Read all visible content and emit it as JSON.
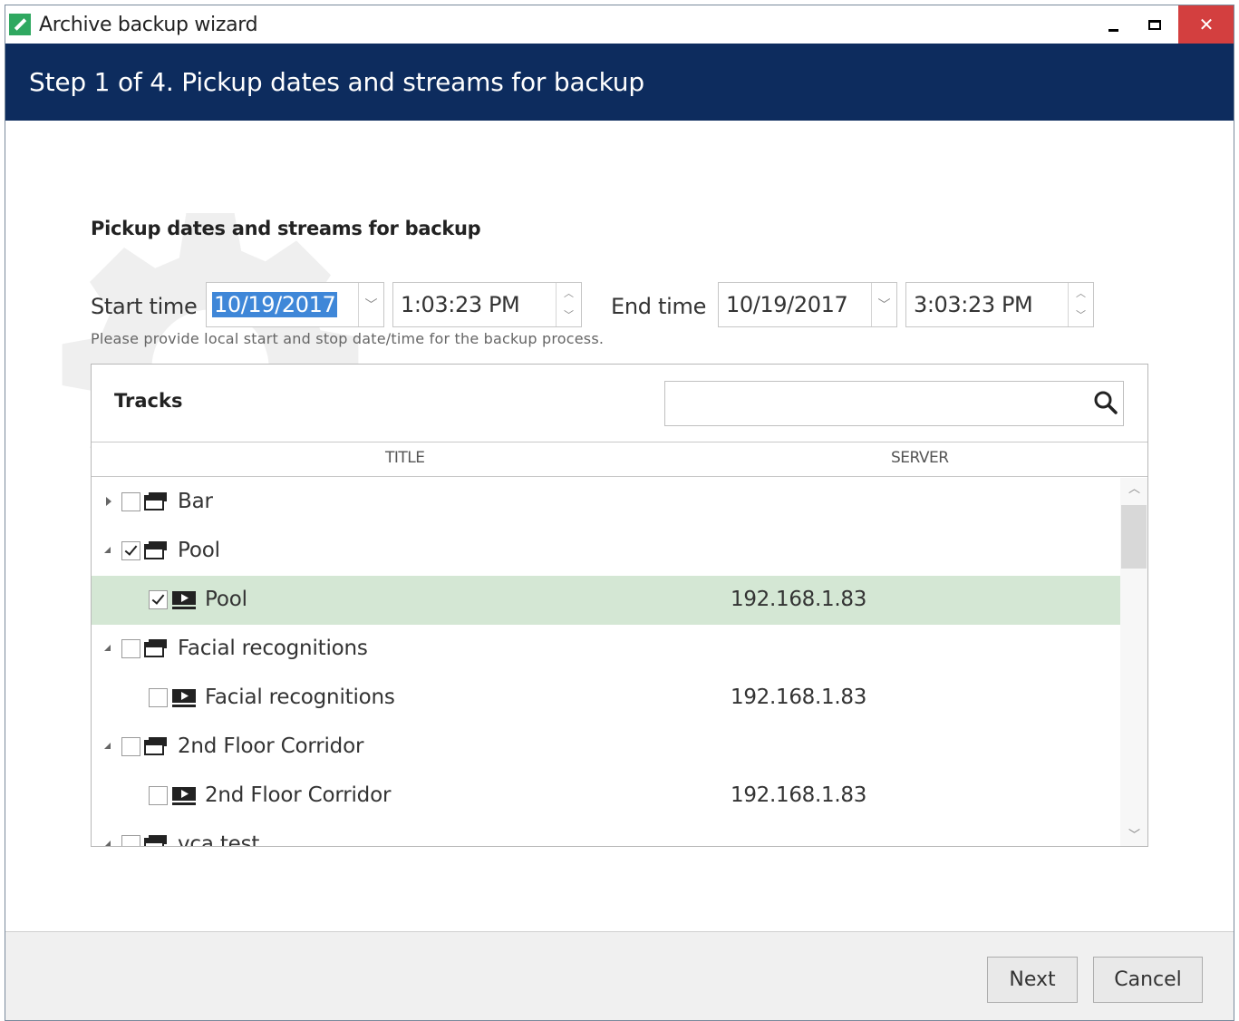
{
  "window": {
    "title": "Archive backup wizard",
    "minimize_glyph": "–",
    "maximize_glyph": "□",
    "close_glyph": "✕",
    "accent_header": "#0d2c5e",
    "close_color": "#d33f3f"
  },
  "header": {
    "step_text": "Step 1 of 4. Pickup dates and streams for backup"
  },
  "form": {
    "section_title": "Pickup dates and streams for backup",
    "start_label": "Start time",
    "start_date": "10/19/2017",
    "start_time": "1:03:23 PM",
    "end_label": "End time",
    "end_date": "10/19/2017",
    "end_time": "3:03:23 PM",
    "hint": "Please provide local start and stop date/time for the backup process."
  },
  "tracks": {
    "title": "Tracks",
    "search_value": "",
    "columns": {
      "title": "TITLE",
      "server": "SERVER"
    },
    "rows": [
      {
        "label": "Bar",
        "type": "group",
        "expanded": false,
        "checked": false,
        "server": ""
      },
      {
        "label": "Pool",
        "type": "group",
        "expanded": true,
        "checked": true,
        "server": ""
      },
      {
        "label": "Pool",
        "type": "stream",
        "checked": true,
        "selected": true,
        "server": "192.168.1.83"
      },
      {
        "label": "Facial recognitions",
        "type": "group",
        "expanded": true,
        "checked": false,
        "server": ""
      },
      {
        "label": "Facial recognitions",
        "type": "stream",
        "checked": false,
        "server": "192.168.1.83"
      },
      {
        "label": "2nd Floor Corridor",
        "type": "group",
        "expanded": true,
        "checked": false,
        "server": ""
      },
      {
        "label": "2nd Floor Corridor",
        "type": "stream",
        "checked": false,
        "server": "192.168.1.83"
      },
      {
        "label": "vca test",
        "type": "group",
        "expanded": true,
        "checked": false,
        "server": ""
      }
    ],
    "selected_row_color": "#d4e7d4"
  },
  "footer": {
    "next_label": "Next",
    "cancel_label": "Cancel"
  },
  "icons": {
    "app": "archive-wizard-icon",
    "search": "search-icon",
    "group": "camera-group-icon",
    "stream": "video-stream-icon",
    "dropdown": "chevron-down-icon",
    "spin_up": "chevron-up-icon",
    "spin_down": "chevron-down-icon"
  }
}
